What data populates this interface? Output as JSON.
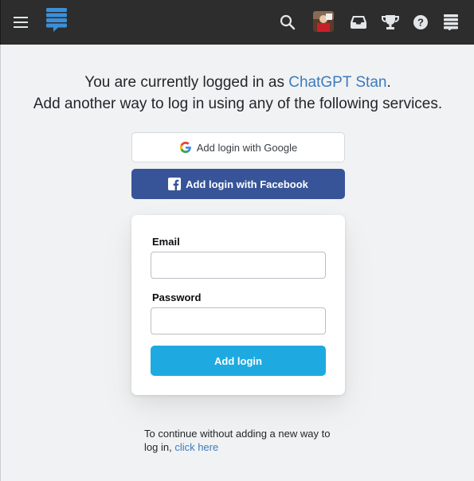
{
  "topbar": {
    "menu_icon": "hamburger-icon",
    "logo_icon": "stack-logo-icon",
    "search_icon": "search-icon",
    "inbox_icon": "inbox-icon",
    "achievements_icon": "trophy-icon",
    "help_icon": "help-icon",
    "switcher_icon": "site-switcher-icon",
    "bg_color": "#2d2d2d"
  },
  "intro": {
    "line1_prefix": "You are currently logged in as ",
    "username": "ChatGPT Stan",
    "line1_suffix": ".",
    "line2": "Add another way to log in using any of the following services."
  },
  "oauth": {
    "google_label": "Add login with Google",
    "facebook_label": "Add login with Facebook",
    "facebook_color": "#385499"
  },
  "form": {
    "email_label": "Email",
    "email_value": "",
    "password_label": "Password",
    "password_value": "",
    "submit_label": "Add login",
    "submit_color": "#1eaae0"
  },
  "footer": {
    "text": "To continue without adding a new way to log in, ",
    "link": "click here"
  }
}
